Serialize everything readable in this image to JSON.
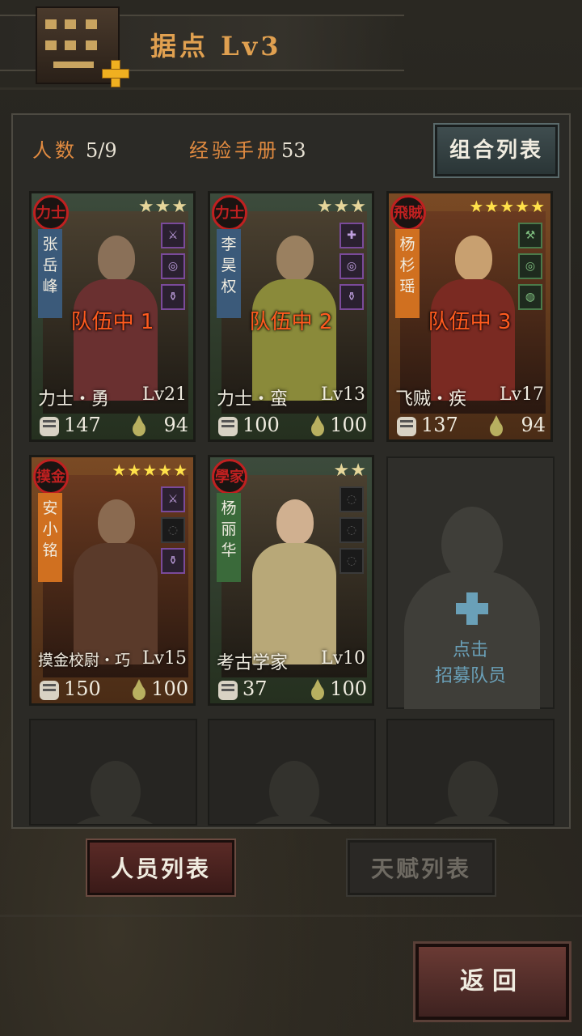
{
  "header": {
    "title": "据点  Lv3"
  },
  "stats": {
    "members_label": "人数",
    "members_value": "5/9",
    "exp_label": "经验手册",
    "exp_value": "53"
  },
  "combo_button": "组合列表",
  "cards": [
    {
      "badge": "力士",
      "name": "张岳峰",
      "stars": "★★★",
      "status": "队伍中 1",
      "class": "力士・勇",
      "level": "Lv21",
      "power": "147",
      "stamina": "94"
    },
    {
      "badge": "力士",
      "name": "李昊权",
      "stars": "★★★",
      "status": "队伍中 2",
      "class": "力士・蛮",
      "level": "Lv13",
      "power": "100",
      "stamina": "100"
    },
    {
      "badge": "飛賊",
      "name": "杨杉瑶",
      "stars": "★★★★★",
      "status": "队伍中 3",
      "class": "飞贼・疾",
      "level": "Lv17",
      "power": "137",
      "stamina": "94"
    },
    {
      "badge": "摸金",
      "name": "安小铭",
      "stars": "★★★★★",
      "class": "摸金校尉・巧",
      "level": "Lv15",
      "power": "150",
      "stamina": "100"
    },
    {
      "badge": "學家",
      "name": "杨丽华",
      "stars": "★★",
      "class": "考古学家",
      "level": "Lv10",
      "power": "37",
      "stamina": "100"
    }
  ],
  "recruit": {
    "line1": "点击",
    "line2": "招募队员"
  },
  "tabs": {
    "members": "人员列表",
    "talents": "天赋列表"
  },
  "back_button": "返回",
  "icons": {
    "power": "fist-icon",
    "stamina": "drop-icon",
    "add": "plus-icon"
  },
  "colors": {
    "accent": "#e08a40",
    "in_team": "#ff5a1e",
    "recruit": "#6aa0b8"
  }
}
